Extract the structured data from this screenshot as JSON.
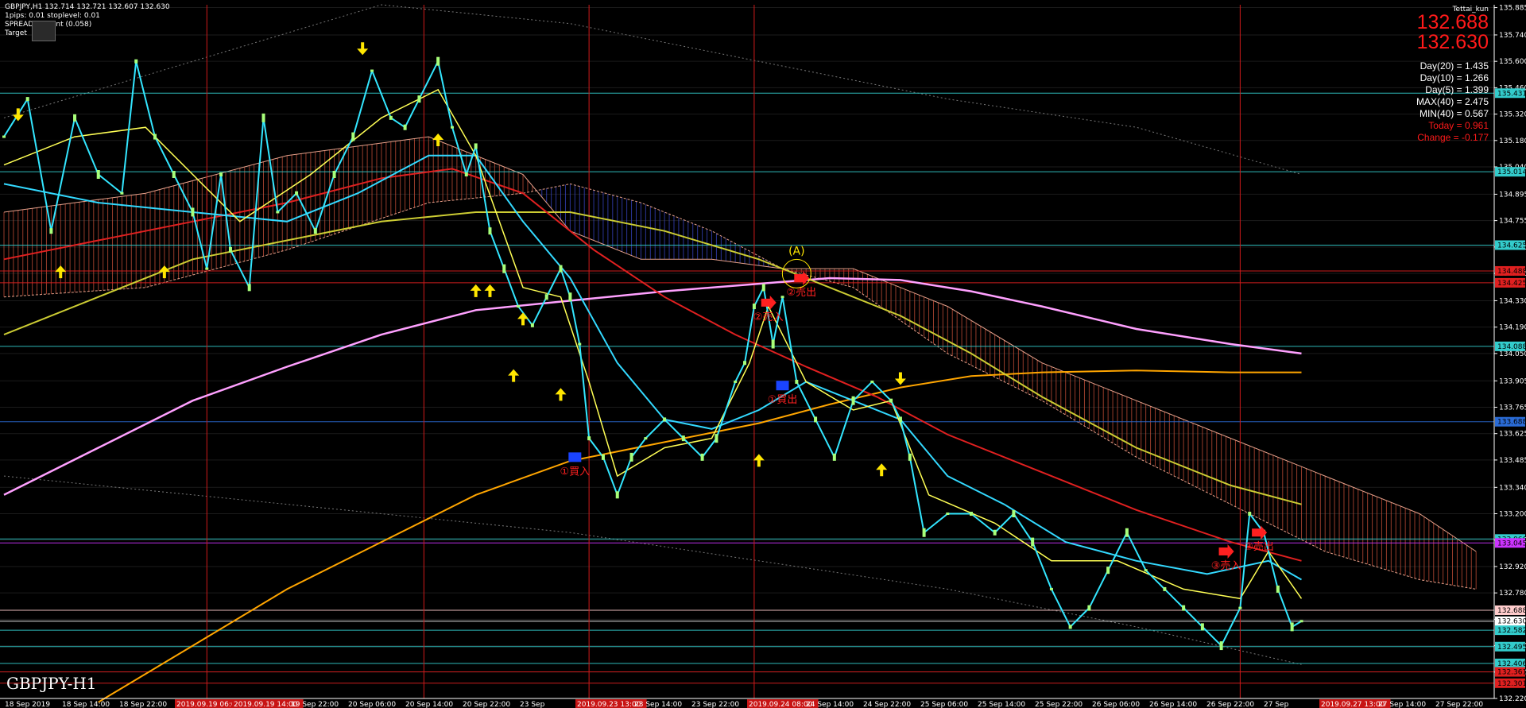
{
  "header": {
    "symbol_line": "GBPJPY,H1  132.714 132.721 132.607 132.630",
    "pips_line": "1pips: 0.01  stoplevel: 0.01",
    "spread_line": "SPREAD: 5 point (0.058)",
    "target_line": "Target"
  },
  "watermark": "GBPJPY-H1",
  "user": "Tettai_kun",
  "quote": {
    "bid": "132.688",
    "ask": "132.630"
  },
  "stats": [
    {
      "text": "Day(20) = 1.435",
      "color": "#ffffff"
    },
    {
      "text": "Day(10) = 1.266",
      "color": "#ffffff"
    },
    {
      "text": "Day(5) = 1.399",
      "color": "#ffffff"
    },
    {
      "text": "MAX(40) = 2.475",
      "color": "#ffffff"
    },
    {
      "text": "MIN(40) = 0.567",
      "color": "#ffffff"
    },
    {
      "text": "Today = 0.961",
      "color": "#ff1a1a"
    },
    {
      "text": "Change = -0.177",
      "color": "#ff1a1a"
    }
  ],
  "chart_data": {
    "type": "line",
    "symbol": "GBPJPY",
    "timeframe": "H1",
    "ylim": [
      132.22,
      135.9
    ],
    "y_ticks": [
      "135.885",
      "135.740",
      "135.600",
      "135.460",
      "135.320",
      "135.180",
      "135.040",
      "134.895",
      "134.755",
      "134.615",
      "134.475",
      "134.330",
      "134.190",
      "134.050",
      "133.905",
      "133.765",
      "133.625",
      "133.485",
      "133.340",
      "133.200",
      "133.060",
      "132.920",
      "132.780",
      "132.640",
      "132.500",
      "132.360",
      "132.220"
    ],
    "x_ticks": [
      "18 Sep 2019",
      "18 Sep 14:00",
      "18 Sep 22:00",
      "2019.09.19 06:00",
      "2019.09.19 14:00",
      "19 Sep 22:00",
      "20 Sep 06:00",
      "20 Sep 14:00",
      "20 Sep 22:00",
      "23 Sep",
      "2019.09.23 13:00",
      "23 Sep 14:00",
      "23 Sep 22:00",
      "2019.09.24 08:00",
      "24 Sep 14:00",
      "24 Sep 22:00",
      "25 Sep 06:00",
      "25 Sep 14:00",
      "25 Sep 22:00",
      "26 Sep 06:00",
      "26 Sep 14:00",
      "26 Sep 22:00",
      "27 Sep",
      "2019.09.27 13:00",
      "27 Sep 14:00",
      "27 Sep 22:00"
    ],
    "x_ticks_highlight": [
      "2019.09.19 06:00",
      "2019.09.19 14:00",
      "2019.09.23 13:00",
      "2019.09.24 08:00",
      "2019.09.27 13:00"
    ],
    "price_levels": [
      {
        "label": "135.431",
        "value": 135.431,
        "color": "#33cccc"
      },
      {
        "label": "135.014",
        "value": 135.014,
        "color": "#33cccc"
      },
      {
        "label": "134.625",
        "value": 134.625,
        "color": "#33cccc"
      },
      {
        "label": "134.488",
        "value": 134.488,
        "color": "#e02020"
      },
      {
        "label": "134.425",
        "value": 134.425,
        "color": "#e02020"
      },
      {
        "label": "134.088",
        "value": 134.088,
        "color": "#33cccc"
      },
      {
        "label": "133.688",
        "value": 133.688,
        "color": "#2a6bd6"
      },
      {
        "label": "133.066",
        "value": 133.066,
        "color": "#33cccc"
      },
      {
        "label": "133.045",
        "value": 133.045,
        "color": "#cc33ff"
      },
      {
        "label": "132.688",
        "value": 132.688,
        "color": "#ffcccc"
      },
      {
        "label": "132.630",
        "value": 132.63,
        "color": "#ffffff"
      },
      {
        "label": "132.582",
        "value": 132.582,
        "color": "#33cccc"
      },
      {
        "label": "132.495",
        "value": 132.495,
        "color": "#33cccc"
      },
      {
        "label": "132.406",
        "value": 132.406,
        "color": "#33cccc"
      },
      {
        "label": "132.361",
        "value": 132.361,
        "color": "#e02020"
      },
      {
        "label": "132.301",
        "value": 132.301,
        "color": "#e02020"
      }
    ],
    "price": [
      [
        0,
        135.2
      ],
      [
        5,
        135.4
      ],
      [
        10,
        134.7
      ],
      [
        15,
        135.3
      ],
      [
        20,
        135.0
      ],
      [
        25,
        134.9
      ],
      [
        28,
        135.6
      ],
      [
        32,
        135.2
      ],
      [
        36,
        135.0
      ],
      [
        40,
        134.8
      ],
      [
        43,
        134.5
      ],
      [
        46,
        135.0
      ],
      [
        48,
        134.6
      ],
      [
        52,
        134.4
      ],
      [
        55,
        135.3
      ],
      [
        58,
        134.8
      ],
      [
        62,
        134.9
      ],
      [
        66,
        134.7
      ],
      [
        70,
        135.0
      ],
      [
        74,
        135.2
      ],
      [
        78,
        135.55
      ],
      [
        82,
        135.3
      ],
      [
        85,
        135.25
      ],
      [
        88,
        135.4
      ],
      [
        92,
        135.6
      ],
      [
        95,
        135.25
      ],
      [
        98,
        135.0
      ],
      [
        100,
        135.15
      ],
      [
        103,
        134.7
      ],
      [
        106,
        134.5
      ],
      [
        109,
        134.3
      ],
      [
        112,
        134.2
      ],
      [
        115,
        134.35
      ],
      [
        118,
        134.5
      ],
      [
        120,
        134.35
      ],
      [
        122,
        134.1
      ],
      [
        124,
        133.6
      ],
      [
        127,
        133.5
      ],
      [
        130,
        133.3
      ],
      [
        133,
        133.5
      ],
      [
        136,
        133.6
      ],
      [
        140,
        133.7
      ],
      [
        144,
        133.6
      ],
      [
        148,
        133.5
      ],
      [
        151,
        133.6
      ],
      [
        155,
        133.9
      ],
      [
        157,
        134.0
      ],
      [
        159,
        134.3
      ],
      [
        161,
        134.4
      ],
      [
        163,
        134.1
      ],
      [
        165,
        134.35
      ],
      [
        168,
        133.9
      ],
      [
        172,
        133.7
      ],
      [
        176,
        133.5
      ],
      [
        180,
        133.8
      ],
      [
        184,
        133.9
      ],
      [
        188,
        133.8
      ],
      [
        190,
        133.7
      ],
      [
        192,
        133.5
      ],
      [
        195,
        133.1
      ],
      [
        200,
        133.2
      ],
      [
        205,
        133.2
      ],
      [
        210,
        133.1
      ],
      [
        214,
        133.2
      ],
      [
        218,
        133.05
      ],
      [
        222,
        132.8
      ],
      [
        226,
        132.6
      ],
      [
        230,
        132.7
      ],
      [
        234,
        132.9
      ],
      [
        238,
        133.1
      ],
      [
        242,
        132.9
      ],
      [
        246,
        132.8
      ],
      [
        250,
        132.7
      ],
      [
        254,
        132.6
      ],
      [
        258,
        132.5
      ],
      [
        262,
        132.7
      ],
      [
        264,
        133.2
      ],
      [
        267,
        133.1
      ],
      [
        270,
        132.8
      ],
      [
        273,
        132.6
      ],
      [
        275,
        132.63
      ]
    ],
    "pos_ma_fast": [
      [
        0,
        135.05
      ],
      [
        15,
        135.2
      ],
      [
        30,
        135.25
      ],
      [
        50,
        134.75
      ],
      [
        65,
        135.0
      ],
      [
        80,
        135.3
      ],
      [
        92,
        135.45
      ],
      [
        100,
        135.1
      ],
      [
        110,
        134.4
      ],
      [
        118,
        134.35
      ],
      [
        124,
        133.9
      ],
      [
        130,
        133.4
      ],
      [
        140,
        133.55
      ],
      [
        150,
        133.6
      ],
      [
        158,
        134.0
      ],
      [
        162,
        134.3
      ],
      [
        170,
        133.9
      ],
      [
        180,
        133.75
      ],
      [
        188,
        133.8
      ],
      [
        196,
        133.3
      ],
      [
        210,
        133.15
      ],
      [
        222,
        132.95
      ],
      [
        236,
        132.95
      ],
      [
        250,
        132.8
      ],
      [
        262,
        132.75
      ],
      [
        268,
        133.0
      ],
      [
        275,
        132.75
      ]
    ],
    "pos_ma_cyan": [
      [
        0,
        134.95
      ],
      [
        20,
        134.85
      ],
      [
        40,
        134.8
      ],
      [
        60,
        134.75
      ],
      [
        75,
        134.9
      ],
      [
        90,
        135.1
      ],
      [
        100,
        135.1
      ],
      [
        110,
        134.75
      ],
      [
        120,
        134.45
      ],
      [
        130,
        134.0
      ],
      [
        140,
        133.7
      ],
      [
        150,
        133.65
      ],
      [
        160,
        133.75
      ],
      [
        170,
        133.9
      ],
      [
        180,
        133.8
      ],
      [
        190,
        133.7
      ],
      [
        200,
        133.4
      ],
      [
        212,
        133.25
      ],
      [
        225,
        133.05
      ],
      [
        240,
        132.95
      ],
      [
        255,
        132.88
      ],
      [
        268,
        132.95
      ],
      [
        275,
        132.85
      ]
    ],
    "pos_ma_red": [
      [
        0,
        134.55
      ],
      [
        20,
        134.65
      ],
      [
        40,
        134.75
      ],
      [
        60,
        134.85
      ],
      [
        80,
        134.98
      ],
      [
        95,
        135.03
      ],
      [
        110,
        134.9
      ],
      [
        125,
        134.6
      ],
      [
        140,
        134.35
      ],
      [
        155,
        134.15
      ],
      [
        170,
        133.98
      ],
      [
        185,
        133.82
      ],
      [
        200,
        133.62
      ],
      [
        220,
        133.42
      ],
      [
        240,
        133.22
      ],
      [
        260,
        133.05
      ],
      [
        275,
        132.95
      ]
    ],
    "pos_ma_olive": [
      [
        0,
        134.15
      ],
      [
        20,
        134.35
      ],
      [
        40,
        134.55
      ],
      [
        60,
        134.65
      ],
      [
        80,
        134.75
      ],
      [
        100,
        134.8
      ],
      [
        120,
        134.8
      ],
      [
        140,
        134.7
      ],
      [
        160,
        134.55
      ],
      [
        175,
        134.4
      ],
      [
        190,
        134.25
      ],
      [
        205,
        134.05
      ],
      [
        220,
        133.82
      ],
      [
        240,
        133.55
      ],
      [
        260,
        133.35
      ],
      [
        275,
        133.25
      ]
    ],
    "pos_ma_pink": [
      [
        0,
        133.3
      ],
      [
        20,
        133.55
      ],
      [
        40,
        133.8
      ],
      [
        60,
        133.98
      ],
      [
        80,
        134.15
      ],
      [
        100,
        134.28
      ],
      [
        120,
        134.33
      ],
      [
        140,
        134.38
      ],
      [
        160,
        134.42
      ],
      [
        175,
        134.45
      ],
      [
        190,
        134.44
      ],
      [
        205,
        134.38
      ],
      [
        220,
        134.3
      ],
      [
        240,
        134.18
      ],
      [
        260,
        134.1
      ],
      [
        275,
        134.05
      ]
    ],
    "pos_ma_orange": [
      [
        20,
        132.2
      ],
      [
        40,
        132.5
      ],
      [
        60,
        132.8
      ],
      [
        80,
        133.05
      ],
      [
        100,
        133.3
      ],
      [
        120,
        133.48
      ],
      [
        140,
        133.58
      ],
      [
        160,
        133.68
      ],
      [
        175,
        133.78
      ],
      [
        190,
        133.87
      ],
      [
        205,
        133.93
      ],
      [
        220,
        133.95
      ],
      [
        240,
        133.96
      ],
      [
        260,
        133.95
      ],
      [
        275,
        133.95
      ]
    ],
    "cloud_a": [
      [
        0,
        134.8
      ],
      [
        30,
        134.9
      ],
      [
        60,
        135.1
      ],
      [
        90,
        135.2
      ],
      [
        110,
        135.0
      ],
      [
        120,
        134.7
      ],
      [
        135,
        134.55
      ],
      [
        150,
        134.55
      ],
      [
        165,
        134.5
      ],
      [
        180,
        134.5
      ],
      [
        200,
        134.3
      ],
      [
        220,
        134.0
      ],
      [
        240,
        133.8
      ],
      [
        260,
        133.6
      ],
      [
        280,
        133.4
      ],
      [
        300,
        133.2
      ],
      [
        312,
        133.0
      ]
    ],
    "cloud_b": [
      [
        0,
        134.35
      ],
      [
        30,
        134.4
      ],
      [
        60,
        134.6
      ],
      [
        90,
        134.85
      ],
      [
        110,
        134.9
      ],
      [
        120,
        134.95
      ],
      [
        135,
        134.85
      ],
      [
        150,
        134.7
      ],
      [
        165,
        134.5
      ],
      [
        180,
        134.4
      ],
      [
        200,
        134.05
      ],
      [
        220,
        133.8
      ],
      [
        240,
        133.5
      ],
      [
        260,
        133.25
      ],
      [
        280,
        133.0
      ],
      [
        300,
        132.85
      ],
      [
        312,
        132.8
      ]
    ],
    "band_upper": [
      [
        0,
        135.3
      ],
      [
        40,
        135.6
      ],
      [
        80,
        135.9
      ],
      [
        120,
        135.8
      ],
      [
        160,
        135.6
      ],
      [
        200,
        135.4
      ],
      [
        240,
        135.25
      ],
      [
        275,
        135.0
      ]
    ],
    "band_lower": [
      [
        0,
        133.4
      ],
      [
        40,
        133.3
      ],
      [
        80,
        133.2
      ],
      [
        120,
        133.1
      ],
      [
        160,
        132.95
      ],
      [
        200,
        132.8
      ],
      [
        240,
        132.6
      ],
      [
        275,
        132.4
      ]
    ],
    "vlines": [
      43,
      89,
      124,
      159,
      262
    ],
    "annotations": [
      {
        "x": 121,
        "value": 133.5,
        "text": "①買入",
        "kind": "buy",
        "color": "#1a44ff",
        "label_color": "#ff2020"
      },
      {
        "x": 162,
        "value": 134.32,
        "text": "②売入",
        "kind": "sell",
        "color": "#ff2020",
        "label_color": "#ff2020"
      },
      {
        "x": 165,
        "value": 133.88,
        "text": "①買出",
        "kind": "buy",
        "color": "#1a44ff",
        "label_color": "#ff2020"
      },
      {
        "x": 169,
        "value": 134.45,
        "text": "②売出",
        "kind": "sell",
        "color": "#ff2020",
        "label_color": "#ff2020"
      },
      {
        "x": 259,
        "value": 133.0,
        "text": "③売入",
        "kind": "sell",
        "color": "#ff2020",
        "label_color": "#ff2020"
      },
      {
        "x": 266,
        "value": 133.1,
        "text": "③売出",
        "kind": "sell",
        "color": "#ff2020",
        "label_color": "#ff2020"
      },
      {
        "x": 168,
        "value": 134.6,
        "text": "(A)",
        "kind": "label",
        "color": "#ffe600",
        "label_color": "#ffe600"
      }
    ],
    "arrows_down": [
      [
        3,
        135.3
      ],
      [
        76,
        135.65
      ],
      [
        190,
        133.9
      ]
    ],
    "arrows_up": [
      [
        12,
        134.5
      ],
      [
        34,
        134.5
      ],
      [
        92,
        135.2
      ],
      [
        100,
        134.4
      ],
      [
        103,
        134.4
      ],
      [
        110,
        134.25
      ],
      [
        108,
        133.95
      ],
      [
        118,
        133.85
      ],
      [
        160,
        133.5
      ],
      [
        186,
        133.45
      ]
    ]
  }
}
